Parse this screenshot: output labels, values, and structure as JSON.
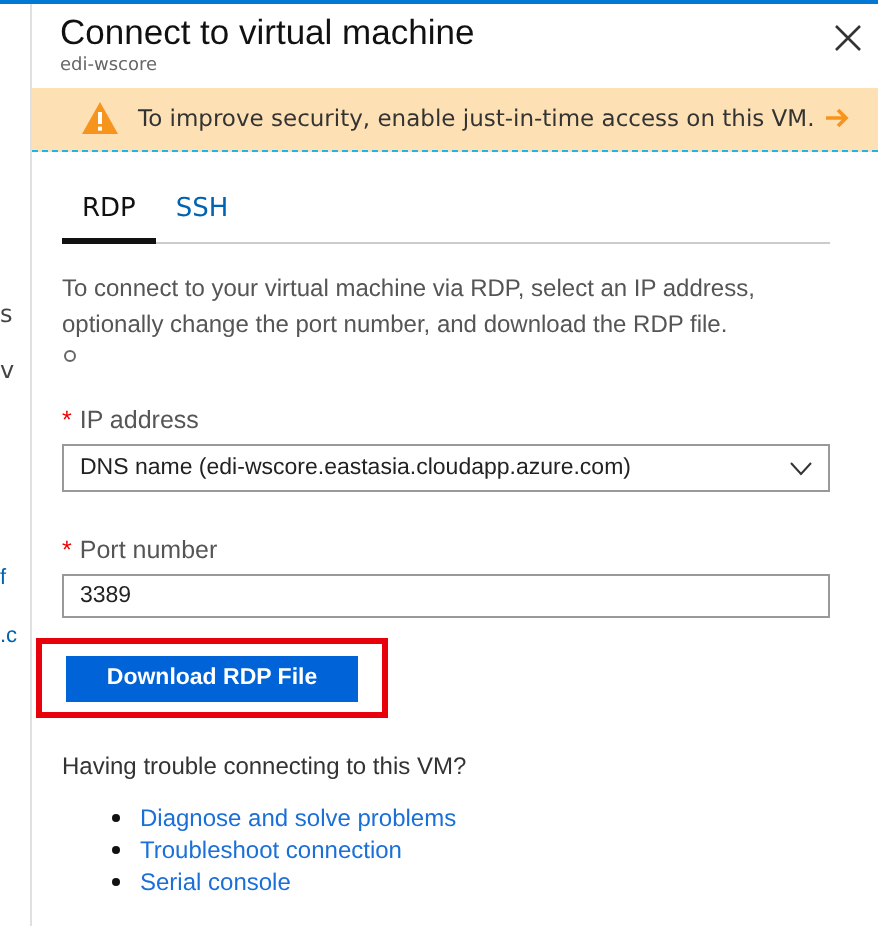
{
  "background_fragments": [
    {
      "text": "s",
      "kind": "plain"
    },
    {
      "text": "v",
      "kind": "plain"
    },
    {
      "text": "f",
      "kind": "link"
    },
    {
      "text": ".c",
      "kind": "link"
    }
  ],
  "window": {
    "title": "Connect to virtual machine",
    "subtitle": "edi-wscore"
  },
  "banner": {
    "kind": "warning",
    "message": "To improve security, enable just-in-time access on this VM."
  },
  "tabs": [
    {
      "label": "RDP",
      "selected": true
    },
    {
      "label": "SSH",
      "selected": false
    }
  ],
  "description": "To connect to your virtual machine via RDP, select an IP address, optionally change the port number, and download the RDP file.",
  "ip_address": {
    "label": "IP address",
    "required": true,
    "required_mark": "*",
    "value": "DNS name (edi-wscore.eastasia.cloudapp.azure.com)"
  },
  "port_number": {
    "label": "Port number",
    "required": true,
    "required_mark": "*",
    "value": "3389"
  },
  "download_button": {
    "label": "Download RDP File",
    "highlighted": true
  },
  "help": {
    "heading": "Having trouble connecting to this VM?",
    "links": [
      "Diagnose and solve problems",
      "Troubleshoot connection",
      "Serial console"
    ]
  }
}
